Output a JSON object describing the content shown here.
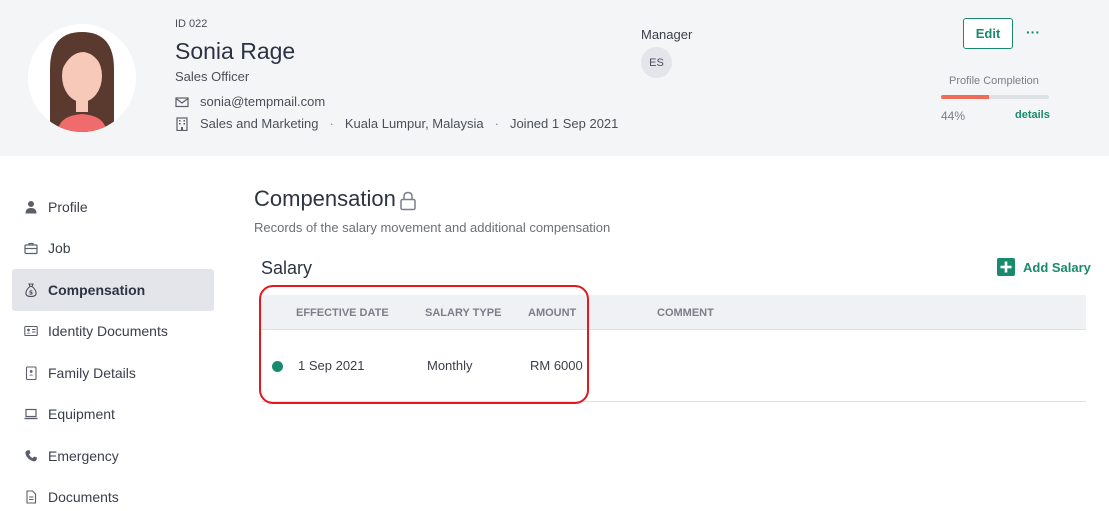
{
  "employee": {
    "id": "ID 022",
    "name": "Sonia Rage",
    "title": "Sales Officer",
    "email": "sonia@tempmail.com",
    "department": "Sales and Marketing",
    "location": "Kuala Lumpur, Malaysia",
    "joined": "Joined 1 Sep 2021",
    "separator": "·"
  },
  "manager": {
    "label": "Manager",
    "initials": "ES"
  },
  "actions": {
    "edit_label": "Edit",
    "more_label": "···"
  },
  "profile_completion": {
    "label": "Profile Completion",
    "percent_text": "44%",
    "percent_value": 44,
    "details_label": "details",
    "fill_color": "#f06b5a"
  },
  "sidebar": {
    "items": [
      {
        "label": "Profile",
        "icon": "user-icon",
        "active": false
      },
      {
        "label": "Job",
        "icon": "briefcase-icon",
        "active": false
      },
      {
        "label": "Compensation",
        "icon": "money-bag-icon",
        "active": true
      },
      {
        "label": "Identity Documents",
        "icon": "id-card-icon",
        "active": false
      },
      {
        "label": "Family Details",
        "icon": "family-book-icon",
        "active": false
      },
      {
        "label": "Equipment",
        "icon": "laptop-icon",
        "active": false
      },
      {
        "label": "Emergency",
        "icon": "phone-icon",
        "active": false
      },
      {
        "label": "Documents",
        "icon": "document-icon",
        "active": false
      }
    ]
  },
  "compensation": {
    "title": "Compensation",
    "description": "Records of the salary movement and additional compensation"
  },
  "salary": {
    "title": "Salary",
    "add_label": "Add Salary",
    "columns": [
      "EFFECTIVE DATE",
      "SALARY TYPE",
      "AMOUNT",
      "COMMENT"
    ],
    "rows": [
      {
        "effective_date": "1 Sep 2021",
        "salary_type": "Monthly",
        "amount": "RM 6000",
        "comment": "",
        "status_color": "#1a8a6e"
      }
    ]
  },
  "colors": {
    "accent": "#1a8a6e",
    "highlight": "#e2191e",
    "header_bg": "#f4f5f7"
  }
}
